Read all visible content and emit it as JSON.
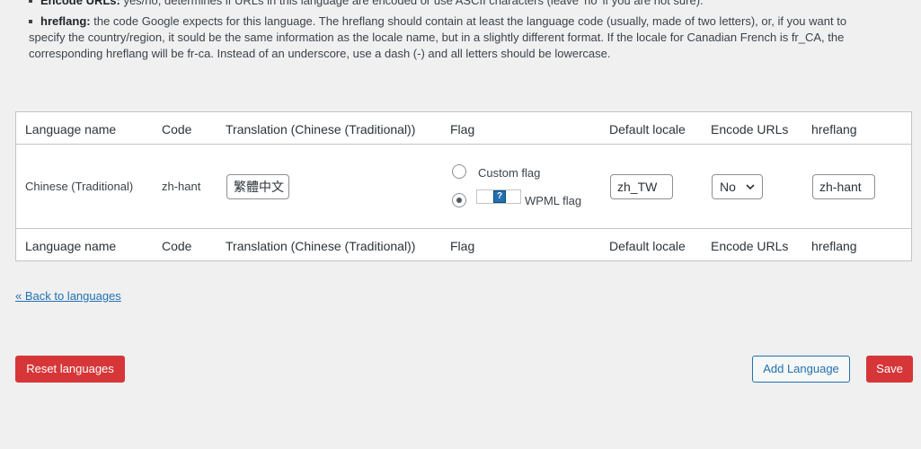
{
  "help": {
    "encode_term": "Encode URLs:",
    "encode_text": " yes/no, determines if URLs in this language are encoded or use ASCII characters (leave 'no' if you are not sure).",
    "hreflang_term": "hreflang:",
    "hreflang_text_1": " the code Google expects for this language. The hreflang should contain at least the language code (usually, made of two letters), or, if you want to",
    "hreflang_text_2": "specify the country/region, it sould be the same information as the locale name, but in a slightly different format. If the locale for Canadian French is fr_CA, the",
    "hreflang_text_3": "corresponding hreflang will be fr-ca. Instead of an underscore, use a dash (-) and all letters should be lowercase."
  },
  "table": {
    "columns": [
      "Language name",
      "Code",
      "Translation (Chinese (Traditional))",
      "Flag",
      "Default locale",
      "Encode URLs",
      "hreflang"
    ],
    "row": {
      "language_name": "Chinese (Traditional)",
      "code": "zh-hant",
      "translation_value": "繁體中文",
      "flag_custom_label": "Custom flag",
      "flag_wpml_label": "WPML flag",
      "flag_selected": "WPML flag",
      "default_locale_value": "zh_TW",
      "encode_urls_value": "No",
      "hreflang_value": "zh-hant"
    }
  },
  "links": {
    "back": "« Back to languages"
  },
  "buttons": {
    "reset": "Reset languages",
    "add_language": "Add Language",
    "save": "Save"
  },
  "colors": {
    "accent": "#2271b1",
    "danger": "#d63638",
    "background": "#f0f0f1"
  },
  "icons": {
    "flag_placeholder": "question-flag-icon",
    "select_arrow": "chevron-down-icon"
  }
}
